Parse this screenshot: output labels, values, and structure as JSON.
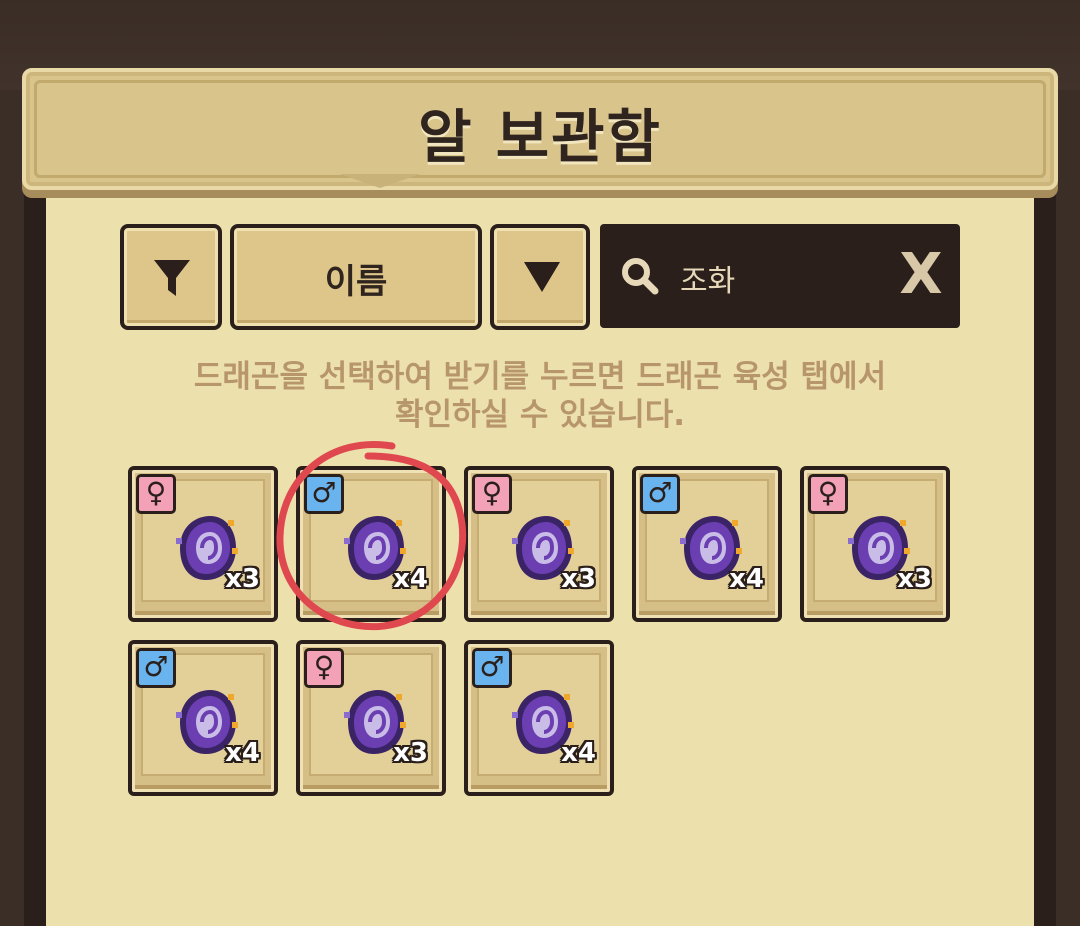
{
  "header": {
    "title": "알 보관함"
  },
  "toolbar": {
    "sort_label": "이름",
    "search_value": "조화",
    "clear_label": "X"
  },
  "hint": {
    "line1": "드래곤을 선택하여 받기를 누르면 드래곤 육성 탭에서",
    "line2": "확인하실 수 있습니다."
  },
  "colors": {
    "female": "#f2a1b6",
    "male": "#69b4ef",
    "highlight": "#e0484f"
  },
  "eggs": [
    {
      "gender": "female",
      "gender_symbol": "♀",
      "count": "x3",
      "icon": "purple-egg-icon"
    },
    {
      "gender": "male",
      "gender_symbol": "♂",
      "count": "x4",
      "icon": "purple-egg-icon",
      "highlighted": true
    },
    {
      "gender": "female",
      "gender_symbol": "♀",
      "count": "x3",
      "icon": "purple-egg-icon"
    },
    {
      "gender": "male",
      "gender_symbol": "♂",
      "count": "x4",
      "icon": "purple-egg-icon"
    },
    {
      "gender": "female",
      "gender_symbol": "♀",
      "count": "x3",
      "icon": "purple-egg-icon"
    },
    {
      "gender": "male",
      "gender_symbol": "♂",
      "count": "x4",
      "icon": "purple-egg-icon"
    },
    {
      "gender": "female",
      "gender_symbol": "♀",
      "count": "x3",
      "icon": "purple-egg-icon"
    },
    {
      "gender": "male",
      "gender_symbol": "♂",
      "count": "x4",
      "icon": "purple-egg-icon"
    }
  ]
}
